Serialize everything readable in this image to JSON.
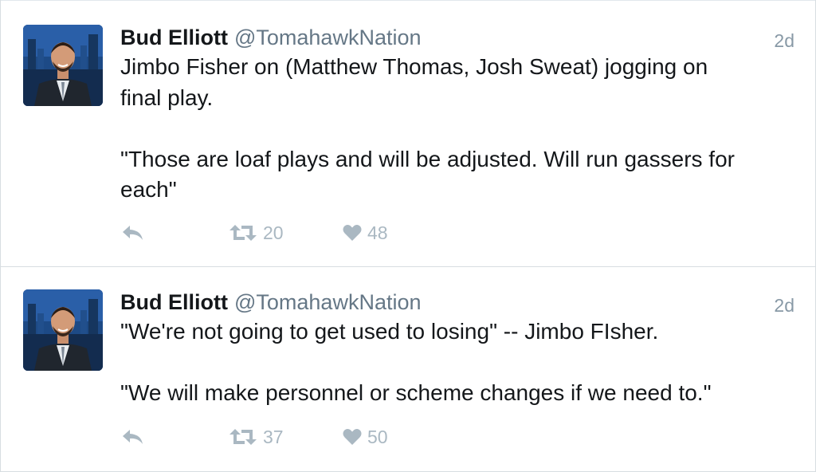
{
  "tweets": [
    {
      "author": {
        "name": "Bud Elliott",
        "handle": "@TomahawkNation"
      },
      "time": "2d",
      "lines": [
        "Jimbo Fisher on (Matthew Thomas, Josh Sweat) jogging on",
        "final play.",
        "",
        "\"Those are loaf plays and will be adjusted. Will run gassers for",
        "each\""
      ],
      "actions": {
        "reply_icon": "reply-icon",
        "retweet_icon": "retweet-icon",
        "retweets": "20",
        "like_icon": "heart-icon",
        "likes": "48"
      }
    },
    {
      "author": {
        "name": "Bud Elliott",
        "handle": "@TomahawkNation"
      },
      "time": "2d",
      "lines": [
        "\"We're not going to get used to losing\" -- Jimbo FIsher.",
        "",
        "\"We will make personnel or scheme changes if we need to.\""
      ],
      "actions": {
        "reply_icon": "reply-icon",
        "retweet_icon": "retweet-icon",
        "retweets": "37",
        "like_icon": "heart-icon",
        "likes": "50"
      }
    }
  ],
  "colors": {
    "text": "#14171a",
    "secondary": "#657786",
    "action_gray": "#aab8c2",
    "divider": "#d8dde1",
    "avatar_bg": "#1b3f77"
  }
}
